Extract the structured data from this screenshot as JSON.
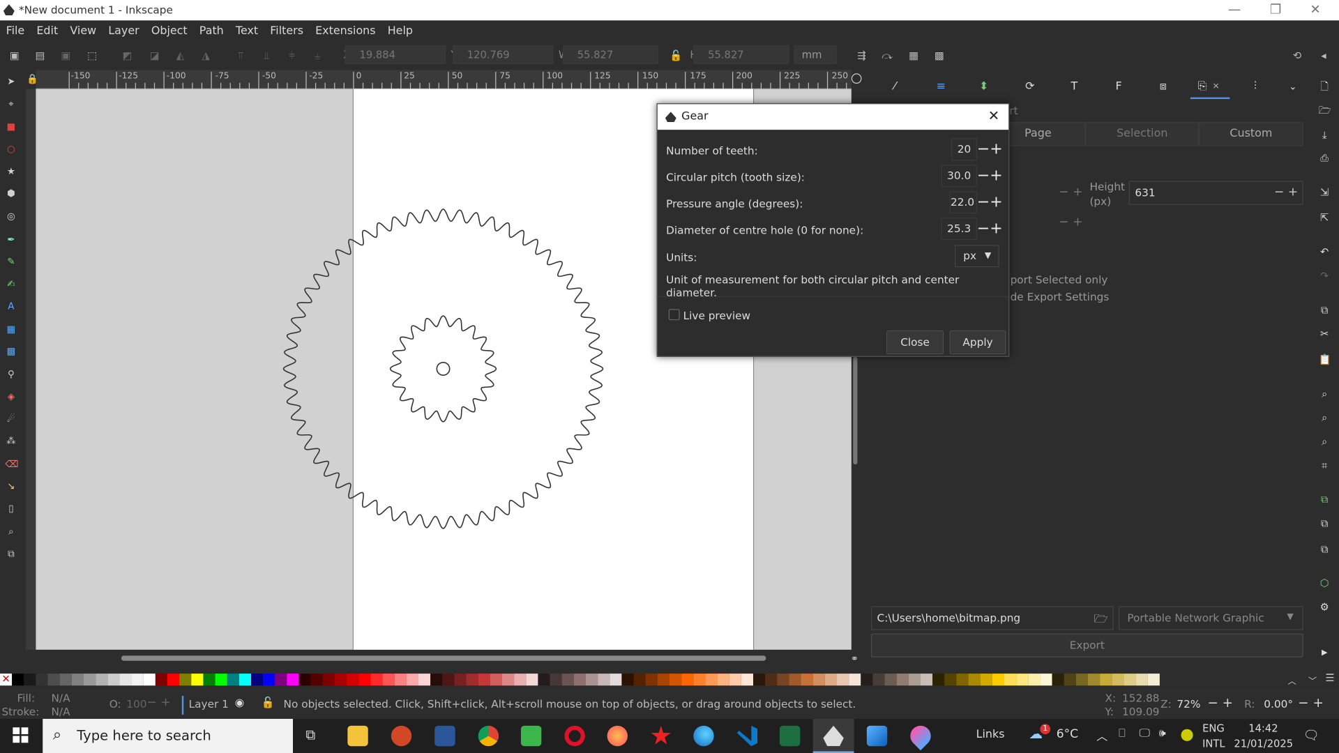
{
  "window": {
    "title": "*New document 1 - Inkscape"
  },
  "menu": [
    "File",
    "Edit",
    "View",
    "Layer",
    "Object",
    "Path",
    "Text",
    "Filters",
    "Extensions",
    "Help"
  ],
  "toolbar": {
    "x_label": "X:",
    "x_value": "19.884",
    "y_label": "Y:",
    "y_value": "120.769",
    "w_label": "W:",
    "w_value": "55.827",
    "h_label": "H:",
    "h_value": "55.827",
    "units": "mm"
  },
  "ruler": [
    "-150",
    "-125",
    "-100",
    "-75",
    "-50",
    "-25",
    "0",
    "25",
    "50",
    "75",
    "100",
    "125",
    "150",
    "175",
    "200",
    "225",
    "250"
  ],
  "dialog": {
    "title": "Gear",
    "teeth_label": "Number of teeth:",
    "teeth_value": "20",
    "pitch_label": "Circular pitch (tooth size):",
    "pitch_value": "30.0",
    "angle_label": "Pressure angle (degrees):",
    "angle_value": "22.0",
    "hole_label": "Diameter of centre hole (0 for none):",
    "hole_value": "25.3",
    "units_label": "Units:",
    "units_value": "px",
    "units_note": "Unit of measurement for both circular pitch and center diameter.",
    "live_preview": "Live preview",
    "close_label": "Close",
    "apply_label": "Apply"
  },
  "export": {
    "tab_tail": "rt",
    "tab_page": "Page",
    "tab_selection": "Selection",
    "tab_custom": "Custom",
    "height_label_1": "Height",
    "height_label_2": "(px)",
    "height_value": "631",
    "export_selected": "port Selected only",
    "hide_settings": "de Export Settings",
    "path": "C:\\Users\\home\\bitmap.png",
    "format": "Portable Network Graphic (*.png)",
    "export_button": "Export"
  },
  "status": {
    "fill_label": "Fill:",
    "fill_value": "N/A",
    "stroke_label": "Stroke:",
    "stroke_value": "N/A",
    "opacity_label": "O:",
    "opacity_value": "100",
    "layer": "Layer 1",
    "message": "No objects selected. Click, Shift+click, Alt+scroll mouse on top of objects, or drag around objects to select.",
    "x_label": "X:",
    "x_value": "152.88",
    "y_label": "Y:",
    "y_value": "109.09",
    "z_label": "Z:",
    "zoom": "72%",
    "r_label": "R:",
    "rotation": "0.00°"
  },
  "taskbar": {
    "search": "Type here to search",
    "links": "Links",
    "temp": "6°C",
    "lang1": "ENG",
    "lang2": "INTL",
    "time": "14:42",
    "date": "21/01/2025",
    "notif_count": "1"
  },
  "colors": {
    "accent": "#5294e2",
    "taskbar_bg": "#1f1f1f",
    "app_bg": "#2d2d2d"
  },
  "palette": [
    "#000000",
    "#1a1a1a",
    "#333333",
    "#4d4d4d",
    "#666666",
    "#808080",
    "#999999",
    "#b3b3b3",
    "#cccccc",
    "#e6e6e6",
    "#f2f2f2",
    "#ffffff",
    "#800000",
    "#ff0000",
    "#808000",
    "#ffff00",
    "#008000",
    "#00ff00",
    "#008080",
    "#00ffff",
    "#000080",
    "#0000ff",
    "#800080",
    "#ff00ff",
    "#2b0000",
    "#550000",
    "#800000",
    "#aa0000",
    "#d40000",
    "#ff0000",
    "#ff2a2a",
    "#ff5555",
    "#ff8080",
    "#ffaaaa",
    "#ffd5d5",
    "#280b0b",
    "#501616",
    "#782121",
    "#a02c2c",
    "#c83737",
    "#d35f5f",
    "#de8787",
    "#e9afaf",
    "#f4d7d7",
    "#241c1c",
    "#483737",
    "#6c5353",
    "#916f6f",
    "#ac9393",
    "#c8b7b7",
    "#e3dbdb",
    "#2b1100",
    "#552200",
    "#803300",
    "#aa4400",
    "#d45500",
    "#ff6600",
    "#ff7f2a",
    "#ff9955",
    "#ffb380",
    "#ffccaa",
    "#ffe6d5",
    "#28170b",
    "#502d16",
    "#784421",
    "#a05a2c",
    "#c87137",
    "#d38d5f",
    "#deaa87",
    "#e9c6af",
    "#f4e3d7",
    "#241f1c",
    "#483e37",
    "#6c5d53",
    "#917c6f",
    "#ac9d93",
    "#c8beb7",
    "#2b2200",
    "#554400",
    "#806600",
    "#aa8800",
    "#d4aa00",
    "#ffcc00",
    "#ffdd55",
    "#ffe680",
    "#ffeeaa",
    "#fff6d5",
    "#28220b",
    "#504416",
    "#786721",
    "#a0892c",
    "#c8ab37",
    "#d3bc5f",
    "#decd87",
    "#e9ddaf",
    "#f4eed7"
  ]
}
